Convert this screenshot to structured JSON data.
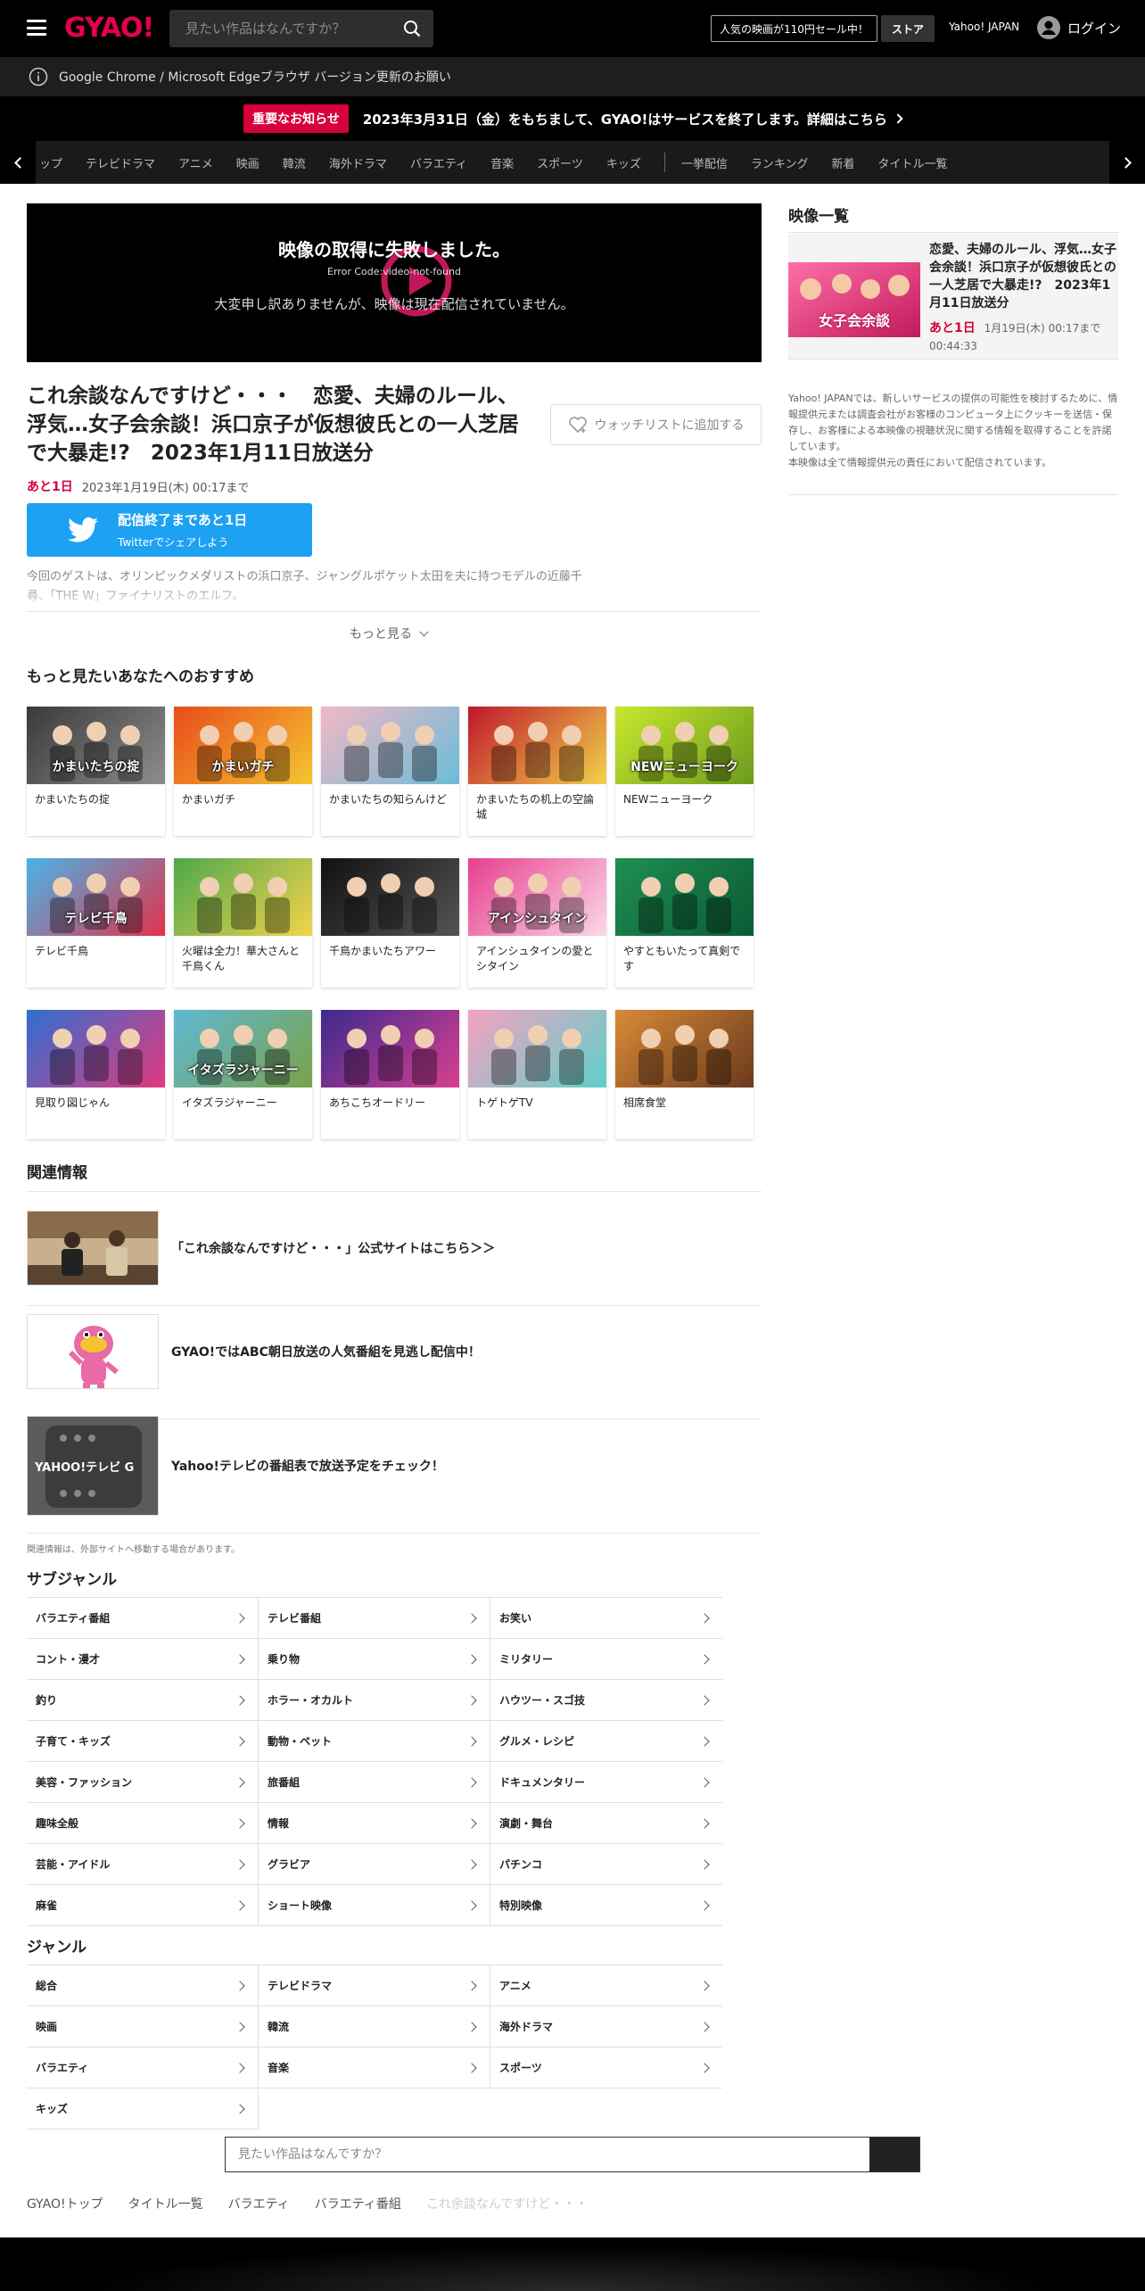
{
  "header": {
    "logo": "GYAO!",
    "search_placeholder": "見たい作品はなんですか？",
    "promo_label": "人気の映画が110円セール中！",
    "store_label": "ストア",
    "yahoo_label": "Yahoo! JAPAN",
    "login_label": "ログイン"
  },
  "browser_notice": "Google Chrome / Microsoft Edgeブラウザ バージョン更新のお願い",
  "important": {
    "badge": "重要なお知らせ",
    "text": "2023年3月31日（金）をもちまして、GYAO!はサービスを終了します。詳細はこちら"
  },
  "nav": {
    "items": [
      "ップ",
      "テレビドラマ",
      "アニメ",
      "映画",
      "韓流",
      "海外ドラマ",
      "バラエティ",
      "音楽",
      "スポーツ",
      "キッズ"
    ],
    "items2": [
      "一挙配信",
      "ランキング",
      "新着",
      "タイトル一覧"
    ]
  },
  "player": {
    "error_title": "映像の取得に失敗しました。",
    "error_code": "Error Code:video-not-found",
    "error_message": "大変申し訳ありませんが、映像は現在配信されていません。"
  },
  "video": {
    "title": "これ余談なんですけど・・・　恋愛、夫婦のルール、浮気…女子会余談！浜口京子が仮想彼氏との一人芝居で大暴走!?　2023年1月11日放送分",
    "watchlist_label": "ウォッチリストに追加する",
    "remaining_badge": "あと1日",
    "remaining_date": "2023年1月19日(木) 00:17まで",
    "twitter_main": "配信終了まであと1日",
    "twitter_sub": "Twitterでシェアしよう",
    "description": "今回のゲストは、オリンピックメダリストの浜口京子、ジャングルポケット太田を夫に持つモデルの近藤千尋、「THE W」ファイナリストのエルフ。",
    "more_label": "もっと見る"
  },
  "reco": {
    "title": "もっと見たいあなたへのおすすめ",
    "items": [
      {
        "label": "かまいたちの掟",
        "thumb_text": "かまいたちの掟",
        "color": "#3a3a3a",
        "color2": "#8d8d8d"
      },
      {
        "label": "かまいガチ",
        "thumb_text": "かまいガチ",
        "color": "#e94b1b",
        "color2": "#f4c430"
      },
      {
        "label": "かまいたちの知らんけど",
        "thumb_text": "",
        "color": "#f2b8c6",
        "color2": "#6bbcd8"
      },
      {
        "label": "かまいたちの机上の空論城",
        "thumb_text": "",
        "color": "#c0162b",
        "color2": "#f1d24a"
      },
      {
        "label": "NEWニューヨーク",
        "thumb_text": "NEWニューヨーク",
        "color": "#c8e82c",
        "color2": "#6b9b1e"
      },
      {
        "label": "テレビ千鳥",
        "thumb_text": "テレビ千鳥",
        "color": "#49b4e8",
        "color2": "#e2324b"
      },
      {
        "label": "火曜は全力！華大さんと千鳥くん",
        "thumb_text": "",
        "color": "#4ea84c",
        "color2": "#f3d34b"
      },
      {
        "label": "千鳥かまいたちアワー",
        "thumb_text": "",
        "color": "#111111",
        "color2": "#555555"
      },
      {
        "label": "アインシュタインの愛とシタイン",
        "thumb_text": "アインシュタイン",
        "color": "#e73f8f",
        "color2": "#fbd8e8"
      },
      {
        "label": "やすともいたって真剣です",
        "thumb_text": "",
        "color": "#1f8f52",
        "color2": "#0b5a34"
      },
      {
        "label": "見取り図じゃん",
        "thumb_text": "",
        "color": "#2f6fd2",
        "color2": "#e2397d"
      },
      {
        "label": "イタズラジャーニー",
        "thumb_text": "イタズラジャーニー",
        "color": "#5fb8d4",
        "color2": "#7aa24a"
      },
      {
        "label": "あちこちオードリー",
        "thumb_text": "",
        "color": "#3b2a8e",
        "color2": "#d93f91"
      },
      {
        "label": "トゲトゲTV",
        "thumb_text": "",
        "color": "#f5a1c2",
        "color2": "#5fd0c9"
      },
      {
        "label": "相席食堂",
        "thumb_text": "",
        "color": "#d98a37",
        "color2": "#6b3a1d"
      }
    ]
  },
  "related": {
    "title": "関連情報",
    "items": [
      {
        "text": "「これ余談なんですけど・・・」公式サイトはこちら＞＞"
      },
      {
        "text": "GYAO!ではABC朝日放送の人気番組を見逃し配信中！"
      },
      {
        "text": "Yahoo!テレビの番組表で放送予定をチェック！",
        "thumb_text": "YAHOO!テレビ G"
      }
    ],
    "note": "関連情報は、外部サイトへ移動する場合があります。"
  },
  "subgenre": {
    "title": "サブジャンル",
    "items": [
      "バラエティ番組",
      "テレビ番組",
      "お笑い",
      "コント・漫才",
      "乗り物",
      "ミリタリー",
      "釣り",
      "ホラー・オカルト",
      "ハウツー・スゴ技",
      "子育て・キッズ",
      "動物・ペット",
      "グルメ・レシピ",
      "美容・ファッション",
      "旅番組",
      "ドキュメンタリー",
      "趣味全般",
      "情報",
      "演劇・舞台",
      "芸能・アイドル",
      "グラビア",
      "パチンコ",
      "麻雀",
      "ショート映像",
      "特別映像"
    ]
  },
  "genre": {
    "title": "ジャンル",
    "items": [
      "総合",
      "テレビドラマ",
      "アニメ",
      "映画",
      "韓流",
      "海外ドラマ",
      "バラエティ",
      "音楽",
      "スポーツ",
      "キッズ"
    ]
  },
  "bottom_search_placeholder": "見たい作品はなんですか？",
  "breadcrumb": [
    "GYAO!トップ",
    "タイトル一覧",
    "バラエティ",
    "バラエティ番組",
    "これ余談なんですけど・・・"
  ],
  "sidebar": {
    "title": "映像一覧",
    "video_title": "恋愛、夫婦のルール、浮気…女子会余談！浜口京子が仮想彼氏との一人芝居で大暴走!?　2023年1月11日放送分",
    "thumb_text": "女子会余談",
    "remaining_badge": "あと1日",
    "remaining_date": "1月19日(木) 00:17まで",
    "duration": "00:44:33",
    "info": "Yahoo! JAPANでは、新しいサービスの提供の可能性を検討するために、情報提供元または調査会社がお客様のコンピュータ上にクッキーを送信・保存し、お客様による本映像の視聴状況に関する情報を取得することを許諾しています。\n本映像は全て情報提供元の責任において配信されています。"
  }
}
